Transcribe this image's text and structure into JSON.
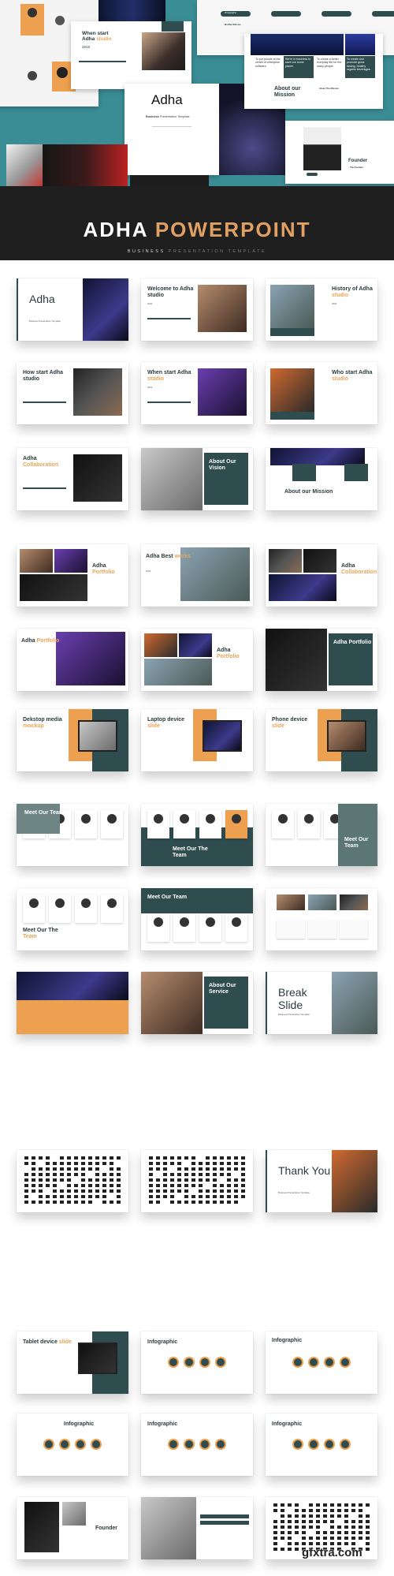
{
  "hero": {
    "when_start_title": "When start",
    "when_start_title2": "Adha",
    "when_start_accent": "studio",
    "when_start_year": "2019",
    "cover_title": "Adha",
    "cover_subtitle_bold": "Business",
    "cover_subtitle": "Presentation Template",
    "mission_title": "About our Mission",
    "mission_label": "About The Mission",
    "mission_boxes": [
      "To put people at the center of enterprise software.",
      "We're in business to save our home planet.",
      "To create a better everyday life for the many people.",
      "To create and promote great tasting, healthy organic beverages."
    ],
    "team_name": "Bodhe Gibson",
    "team_role": "Photographer",
    "founder_title": "Founder",
    "founder_sub": "The Founder"
  },
  "banner": {
    "title_white": "ADHA",
    "title_accent": "POWERPOINT",
    "subtitle_light": "BUSINESS",
    "subtitle_dim": "PRESENTATION TEMPLATE"
  },
  "colors": {
    "teal": "#3b8d95",
    "dark_teal": "#2f4c4f",
    "orange": "#eda04f",
    "banner": "#1f1f1f"
  },
  "slides": [
    {
      "title": "Adha",
      "accent": "",
      "sub": "Business Presentation Template"
    },
    {
      "title": "Welcome to Adha studio",
      "accent": "",
      "sub": "2020"
    },
    {
      "title": "History of Adha",
      "accent": "studio",
      "sub": "2020"
    },
    {
      "title": "How start Adha studio",
      "accent": "",
      "sub": ""
    },
    {
      "title": "When start Adha",
      "accent": "studio",
      "sub": "2019"
    },
    {
      "title": "Who start Adha",
      "accent": "studio",
      "sub": ""
    },
    {
      "title": "Adha",
      "accent": "Collaboration",
      "sub": ""
    },
    {
      "title": "About Our Vision",
      "accent": "",
      "sub": ""
    },
    {
      "title": "About our Mission",
      "accent": "",
      "sub": ""
    },
    {
      "title": "Adha",
      "accent": "Portfolio",
      "sub": ""
    },
    {
      "title": "Adha Best",
      "accent": "works",
      "sub": "2019"
    },
    {
      "title": "Adha",
      "accent": "Collaboration",
      "sub": ""
    },
    {
      "title": "Adha",
      "accent": "Portfolio",
      "sub": ""
    },
    {
      "title": "Adha",
      "accent": "Portfolio",
      "sub": ""
    },
    {
      "title": "Adha Portfolio",
      "accent": "",
      "sub": ""
    },
    {
      "title": "Dekstop media",
      "accent": "mockup",
      "sub": ""
    },
    {
      "title": "Laptop device",
      "accent": "slide",
      "sub": ""
    },
    {
      "title": "Phone device",
      "accent": "slide",
      "sub": ""
    },
    {
      "title": "Meet Our Team",
      "accent": "",
      "sub": ""
    },
    {
      "title": "Meet Our The Team",
      "accent": "",
      "sub": ""
    },
    {
      "title": "Meet Our Team",
      "accent": "",
      "sub": ""
    },
    {
      "title": "Meet Our The",
      "accent": "Team",
      "sub": ""
    },
    {
      "title": "Meet Our Team",
      "accent": "",
      "sub": ""
    },
    {
      "title": "",
      "accent": "",
      "sub": ""
    },
    {
      "title": "",
      "accent": "",
      "sub": ""
    },
    {
      "title": "About Our Service",
      "accent": "",
      "sub": ""
    },
    {
      "title": "Break Slide",
      "accent": "",
      "sub": "Business Presentation Template"
    },
    {
      "title": "",
      "accent": "",
      "sub": ""
    },
    {
      "title": "",
      "accent": "",
      "sub": ""
    },
    {
      "title": "Thank You",
      "accent": "",
      "sub": "Business Presentation Template"
    },
    {
      "title": "Tablet device",
      "accent": "slide",
      "sub": ""
    },
    {
      "title": "Infographic",
      "accent": "",
      "sub": ""
    },
    {
      "title": "Infographic",
      "accent": "",
      "sub": ""
    },
    {
      "title": "Infographic",
      "accent": "",
      "sub": ""
    },
    {
      "title": "Infographic",
      "accent": "",
      "sub": ""
    },
    {
      "title": "Infographic",
      "accent": "",
      "sub": ""
    },
    {
      "title": "Founder",
      "accent": "",
      "sub": ""
    },
    {
      "title": "",
      "accent": "",
      "sub": ""
    },
    {
      "title": "",
      "accent": "",
      "sub": ""
    }
  ],
  "watermark": "gfxtra.com"
}
